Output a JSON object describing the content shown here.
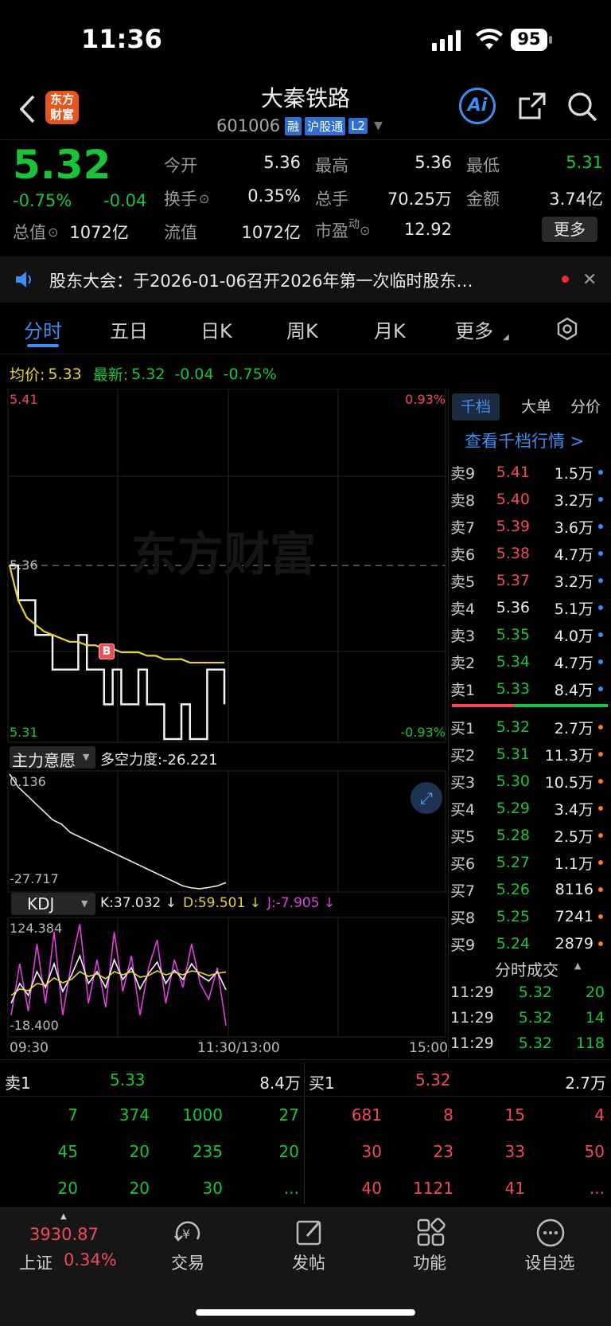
{
  "status_bar": {
    "time": "11:36",
    "battery": "95"
  },
  "header": {
    "logo_text": "东方财富",
    "title": "大秦铁路",
    "code": "601006",
    "badges": [
      "融",
      "沪股通",
      "L2"
    ],
    "ai_label": "Ai"
  },
  "quote": {
    "price": "5.32",
    "change_pct": "-0.75%",
    "change": "-0.04",
    "fields": [
      {
        "label": "今开",
        "value": "5.36",
        "color": "white"
      },
      {
        "label": "最高",
        "value": "5.36",
        "color": "white"
      },
      {
        "label": "最低",
        "value": "5.31",
        "color": "green"
      },
      {
        "label": "换手",
        "value": "0.35%",
        "color": "white"
      },
      {
        "label": "总手",
        "value": "70.25万",
        "color": "white"
      },
      {
        "label": "金额",
        "value": "3.74亿",
        "color": "white"
      },
      {
        "label": "总值",
        "value": "1072亿",
        "color": "white"
      },
      {
        "label": "流值",
        "value": "1072亿",
        "color": "white"
      },
      {
        "label": "市盈",
        "sup": "动",
        "value": "12.92",
        "color": "white"
      }
    ],
    "more_button": "更多"
  },
  "notice": {
    "text": "股东大会：于2026-01-06召开2026年第一次临时股东…"
  },
  "tabs": [
    "分时",
    "五日",
    "日K",
    "周K",
    "月K",
    "更多"
  ],
  "chart_info": {
    "avg_label": "均价:",
    "avg_value": "5.33",
    "latest_label": "最新:",
    "latest_value": "5.32",
    "latest_change": "-0.04",
    "latest_pct": "-0.75%"
  },
  "price_axis": {
    "top": "5.41",
    "top_pct": "0.93%",
    "mid": "5.36",
    "bottom": "5.31",
    "bottom_pct": "-0.93%",
    "watermark": "东方财富",
    "trade_marker": "B"
  },
  "indicator1": {
    "name": "主力意愿",
    "detail": "多空力度:-26.221",
    "top": "0.136",
    "bottom": "-27.717"
  },
  "indicator2": {
    "name": "KDJ",
    "k": "K:37.032 ↓",
    "d": "D:59.501 ↓",
    "j": "J:-7.905 ↓",
    "top": "124.384",
    "bottom": "-18.400"
  },
  "time_axis": [
    "09:30",
    "11:30/13:00",
    "15:00"
  ],
  "side_tabs": [
    "千档",
    "大单",
    "分价"
  ],
  "side_link": "查看千档行情 >",
  "asks": [
    {
      "label": "卖9",
      "price": "5.41",
      "vol": "1.5万",
      "color": "red"
    },
    {
      "label": "卖8",
      "price": "5.40",
      "vol": "3.2万",
      "color": "red"
    },
    {
      "label": "卖7",
      "price": "5.39",
      "vol": "3.6万",
      "color": "red"
    },
    {
      "label": "卖6",
      "price": "5.38",
      "vol": "4.7万",
      "color": "red"
    },
    {
      "label": "卖5",
      "price": "5.37",
      "vol": "3.2万",
      "color": "red"
    },
    {
      "label": "卖4",
      "price": "5.36",
      "vol": "5.1万",
      "color": "white"
    },
    {
      "label": "卖3",
      "price": "5.35",
      "vol": "4.0万",
      "color": "green"
    },
    {
      "label": "卖2",
      "price": "5.34",
      "vol": "4.7万",
      "color": "green"
    },
    {
      "label": "卖1",
      "price": "5.33",
      "vol": "8.4万",
      "color": "green"
    }
  ],
  "bids": [
    {
      "label": "买1",
      "price": "5.32",
      "vol": "2.7万"
    },
    {
      "label": "买2",
      "price": "5.31",
      "vol": "11.3万"
    },
    {
      "label": "买3",
      "price": "5.30",
      "vol": "10.5万"
    },
    {
      "label": "买4",
      "price": "5.29",
      "vol": "3.4万"
    },
    {
      "label": "买5",
      "price": "5.28",
      "vol": "2.5万"
    },
    {
      "label": "买6",
      "price": "5.27",
      "vol": "1.1万"
    },
    {
      "label": "买7",
      "price": "5.26",
      "vol": "8116"
    },
    {
      "label": "买8",
      "price": "5.25",
      "vol": "7241"
    },
    {
      "label": "买9",
      "price": "5.24",
      "vol": "2879"
    }
  ],
  "trades_title": "分时成交",
  "trades": [
    {
      "time": "11:29",
      "price": "5.32",
      "vol": "20"
    },
    {
      "time": "11:29",
      "price": "5.32",
      "vol": "14"
    },
    {
      "time": "11:29",
      "price": "5.32",
      "vol": "118"
    }
  ],
  "queue": {
    "sell_label": "卖1",
    "sell_price": "5.33",
    "sell_vol": "8.4万",
    "buy_label": "买1",
    "buy_price": "5.32",
    "buy_vol": "2.7万",
    "sell_cells": [
      "7",
      "374",
      "1000",
      "27",
      "45",
      "20",
      "235",
      "20",
      "20",
      "20",
      "30",
      "..."
    ],
    "buy_cells": [
      "681",
      "8",
      "15",
      "4",
      "30",
      "23",
      "33",
      "50",
      "40",
      "1121",
      "41",
      "..."
    ]
  },
  "bottom_bar": {
    "index_value": "3930.87",
    "index_name": "上证",
    "index_pct": "0.34%",
    "items": [
      "交易",
      "发帖",
      "功能",
      "设自选"
    ]
  },
  "colors": {
    "up": "#f24957",
    "down": "#19c43b",
    "avg_line": "#e8d23a",
    "accent": "#3f8df0"
  },
  "chart_data": [
    {
      "type": "line",
      "title": "",
      "ylim": [
        5.31,
        5.41
      ],
      "series": [
        {
          "name": "最新",
          "values": [
            5.36,
            5.35,
            5.35,
            5.34,
            5.34,
            5.33,
            5.33,
            5.33,
            5.34,
            5.33,
            5.33,
            5.32,
            5.33,
            5.32,
            5.32,
            5.33,
            5.32,
            5.32,
            5.31,
            5.31,
            5.32,
            5.31,
            5.31,
            5.33,
            5.33,
            5.32
          ]
        },
        {
          "name": "均价",
          "values": [
            5.36,
            5.35,
            5.345,
            5.343,
            5.341,
            5.34,
            5.339,
            5.338,
            5.338,
            5.337,
            5.337,
            5.336,
            5.336,
            5.335,
            5.335,
            5.335,
            5.334,
            5.334,
            5.333,
            5.333,
            5.333,
            5.332,
            5.332,
            5.332,
            5.332,
            5.332
          ]
        }
      ]
    },
    {
      "type": "line",
      "title": "主力意愿",
      "ylim": [
        -27.717,
        0.136
      ],
      "series": [
        {
          "name": "多空力度",
          "values": [
            0.136,
            -3,
            -5,
            -7,
            -9,
            -11,
            -12,
            -14,
            -15,
            -16,
            -17,
            -18,
            -19,
            -20,
            -21,
            -22,
            -23,
            -24,
            -25,
            -26,
            -27,
            -27.5,
            -27.7,
            -27.4,
            -27.0,
            -26.221
          ]
        }
      ]
    },
    {
      "type": "line",
      "title": "KDJ",
      "ylim": [
        -18.4,
        124.384
      ],
      "series": [
        {
          "name": "K",
          "values": [
            20,
            45,
            30,
            60,
            40,
            70,
            35,
            55,
            80,
            45,
            60,
            40,
            75,
            50,
            65,
            38,
            58,
            72,
            45,
            62,
            50,
            70,
            55,
            48,
            60,
            37.032
          ]
        },
        {
          "name": "D",
          "values": [
            30,
            38,
            36,
            45,
            43,
            52,
            46,
            50,
            60,
            54,
            57,
            51,
            60,
            56,
            60,
            53,
            55,
            61,
            56,
            59,
            56,
            61,
            59,
            55,
            58,
            59.501
          ]
        },
        {
          "name": "J",
          "values": [
            5,
            70,
            10,
            95,
            20,
            110,
            5,
            70,
            120,
            20,
            75,
            15,
            110,
            35,
            80,
            5,
            65,
            100,
            20,
            75,
            40,
            95,
            45,
            25,
            65,
            -7.905
          ]
        }
      ]
    }
  ]
}
